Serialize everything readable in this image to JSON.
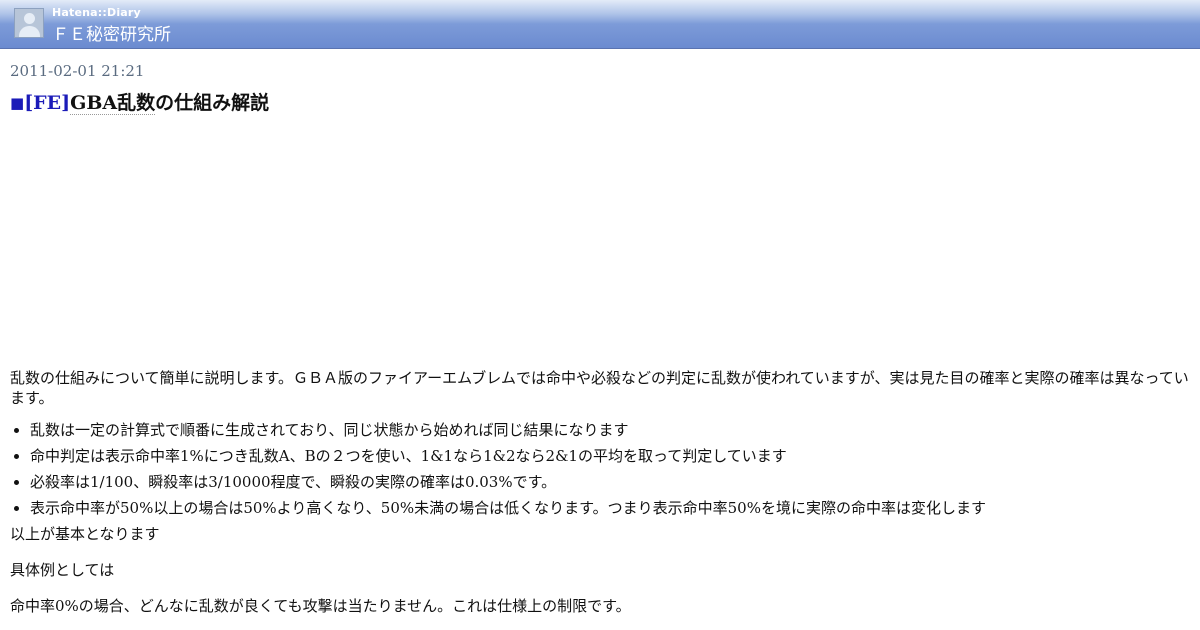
{
  "header": {
    "brand": "Hatena::Diary",
    "blog_title": "ＦＥ秘密研究所"
  },
  "entry": {
    "date": "2011-02-01 21:21",
    "mark": "■",
    "category": "[FE]",
    "title_keyword": "GBA乱数",
    "title_rest": "の仕組み解説"
  },
  "body": {
    "intro": "乱数の仕組みについて簡単に説明します。ＧＢＡ版のファイアーエムブレムでは命中や必殺などの判定に乱数が使われていますが、実は見た目の確率と実際の確率は異なっています。",
    "list": [
      "乱数は一定の計算式で順番に生成されており、同じ状態から始めれば同じ結果になります",
      "命中判定は表示命中率1%につき乱数A、Bの２つを使い、1&1なら1&2なら2&1の平均を取って判定しています",
      "必殺率は1/100、瞬殺率は3/10000程度で、瞬殺の実際の確率は0.03%です。",
      "表示命中率が50%以上の場合は50%より高くなり、50%未満の場合は低くなります。つまり表示命中率50%を境に実際の命中率は変化します"
    ],
    "after_list": "以上が基本となります",
    "section": "具体例としては",
    "last": "命中率0%の場合、どんなに乱数が良くても攻撃は当たりません。これは仕様上の制限です。"
  }
}
